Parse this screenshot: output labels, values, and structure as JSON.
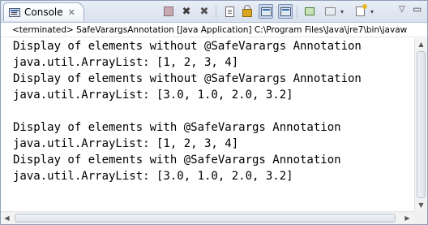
{
  "tab": {
    "label": "Console",
    "close": "✕",
    "icon": "console-icon"
  },
  "toolbar": {
    "buttons": [
      {
        "name": "terminate-icon"
      },
      {
        "name": "remove-launch-icon"
      },
      {
        "name": "remove-all-terminated-icon"
      },
      {
        "name": "clear-console-icon"
      },
      {
        "name": "scroll-lock-icon"
      },
      {
        "name": "show-when-stdout-icon"
      },
      {
        "name": "show-when-stderr-icon"
      },
      {
        "name": "pin-console-icon"
      },
      {
        "name": "display-selected-console-icon"
      },
      {
        "name": "open-console-icon"
      }
    ],
    "remove_glyph": "✖",
    "remove_all_glyph": "✖",
    "dropdown_glyph": "▾",
    "view_menu_glyph": "▽"
  },
  "status": {
    "text": "<terminated> SafeVarargsAnnotation [Java Application] C:\\Program Files\\Java\\jre7\\bin\\javaw"
  },
  "console": {
    "lines": [
      "Display of elements without @SafeVarargs Annotation",
      "java.util.ArrayList: [1, 2, 3, 4]",
      "Display of elements without @SafeVarargs Annotation",
      "java.util.ArrayList: [3.0, 1.0, 2.0, 3.2]",
      "",
      "Display of elements with @SafeVarargs Annotation",
      "java.util.ArrayList: [1, 2, 3, 4]",
      "Display of elements with @SafeVarargs Annotation",
      "java.util.ArrayList: [3.0, 1.0, 2.0, 3.2]"
    ]
  },
  "scroll": {
    "up": "▲",
    "down": "▼",
    "left": "◀",
    "right": "▶"
  }
}
